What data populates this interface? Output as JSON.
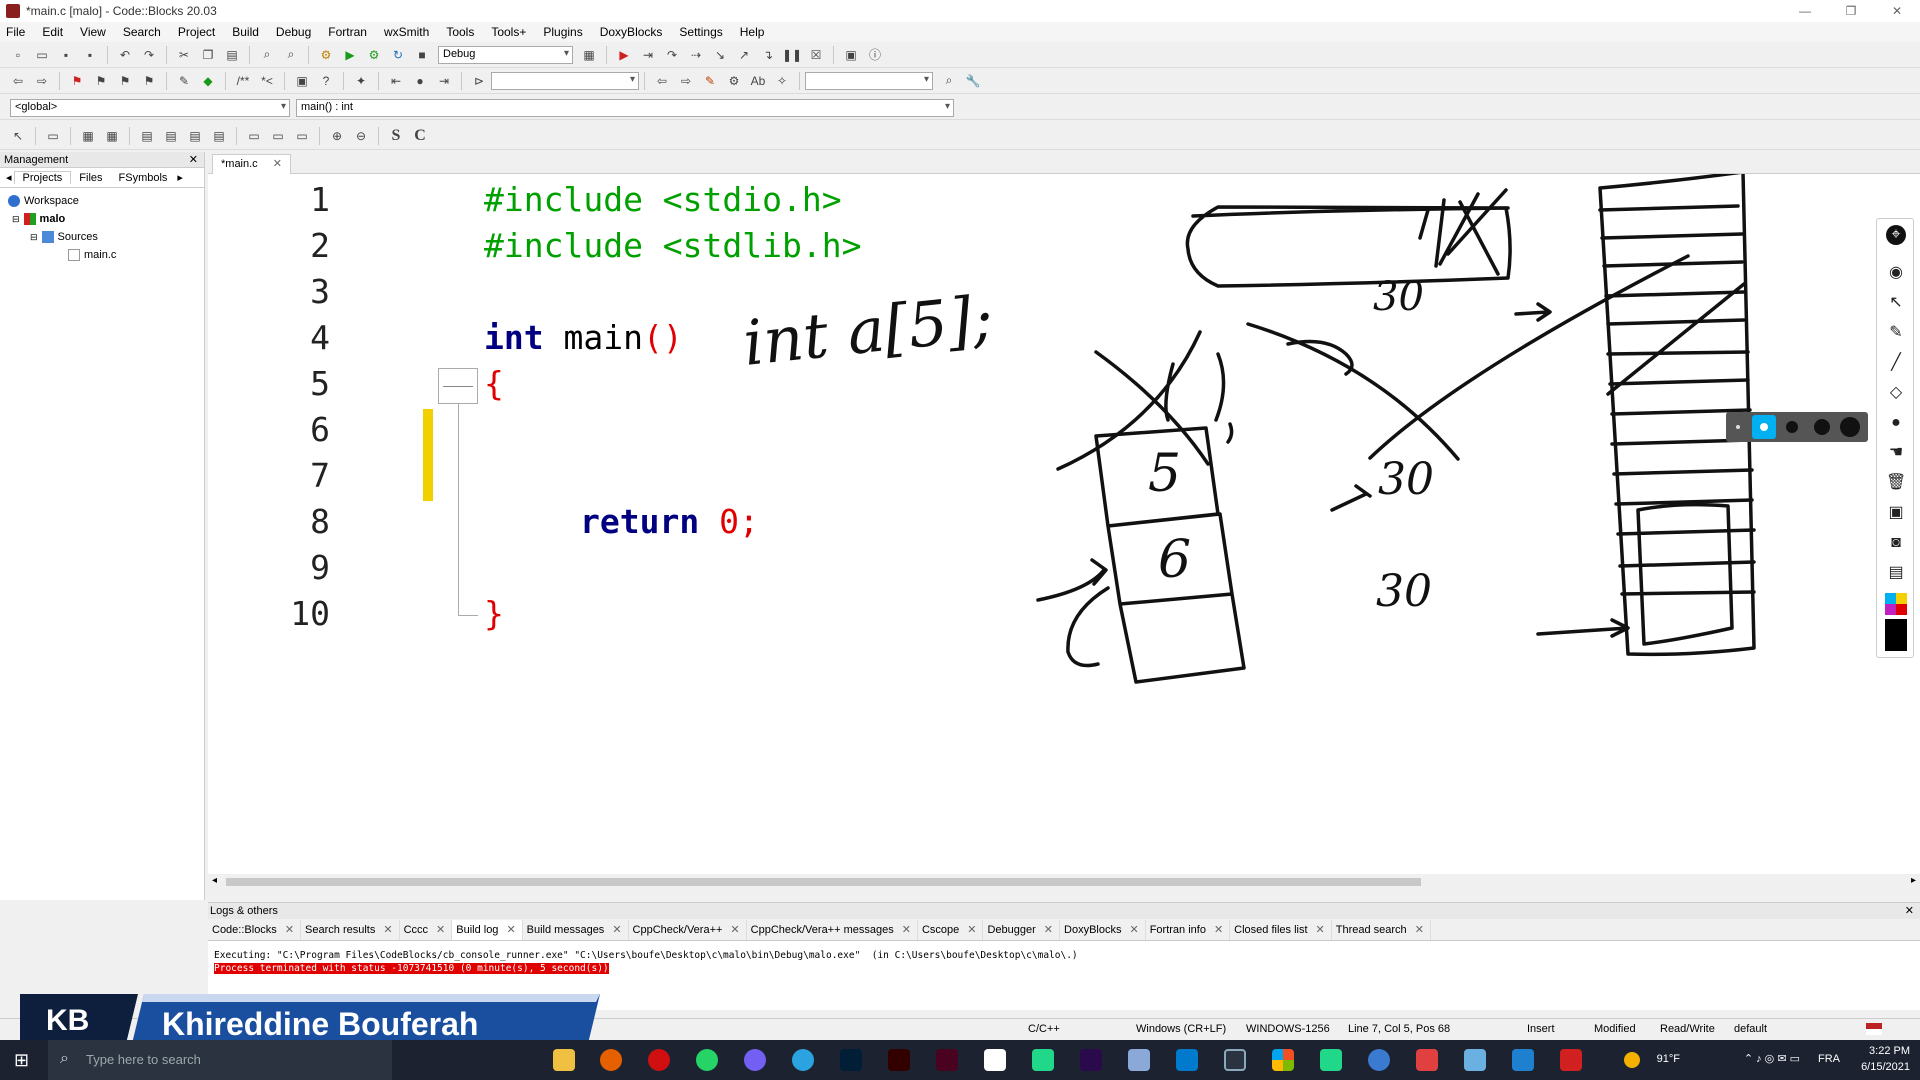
{
  "window": {
    "title": "*main.c [malo] - Code::Blocks 20.03",
    "controls": [
      "—",
      "❐",
      "✕"
    ]
  },
  "menu": [
    "File",
    "Edit",
    "View",
    "Search",
    "Project",
    "Build",
    "Debug",
    "Fortran",
    "wxSmith",
    "Tools",
    "Tools+",
    "Plugins",
    "DoxyBlocks",
    "Settings",
    "Help"
  ],
  "toolbar": {
    "build_target": "Debug",
    "scope": "<global>",
    "symbol": "main() : int"
  },
  "management": {
    "title": "Management",
    "tabs": [
      "Projects",
      "Files",
      "FSymbols"
    ],
    "tree": {
      "workspace": "Workspace",
      "project": "malo",
      "folder": "Sources",
      "file": "main.c"
    }
  },
  "editor": {
    "tab_label": "*main.c",
    "line_numbers": [
      "1",
      "2",
      "3",
      "4",
      "5",
      "6",
      "7",
      "8",
      "9",
      "10"
    ],
    "lines": {
      "l1": "#include <stdio.h>",
      "l2": "#include <stdlib.h>",
      "l4_kw": "int",
      "l4_rest": " main",
      "l4_parens": "()",
      "l5": "{",
      "l8_kw": "return",
      "l8_num": "0",
      "l8_semi": ";",
      "l9": "}"
    }
  },
  "annotations": {
    "decl": "int a[5];",
    "num_top": "30",
    "num_mid": "30",
    "num_bot": "30",
    "box1": "5",
    "box2": "6"
  },
  "logs": {
    "title": "Logs & others",
    "tabs": [
      "Code::Blocks",
      "Search results",
      "Cccc",
      "Build log",
      "Build messages",
      "CppCheck/Vera++",
      "CppCheck/Vera++ messages",
      "Cscope",
      "Debugger",
      "DoxyBlocks",
      "Fortran info",
      "Closed files list",
      "Thread search"
    ],
    "active_tab": "Build log",
    "lines": [
      "Executing: \"C:\\Program Files\\CodeBlocks/cb_console_runner.exe\" \"C:\\Users\\boufe\\Desktop\\c\\malo\\bin\\Debug\\malo.exe\"  (in C:\\Users\\boufe\\Desktop\\c\\malo\\.)",
      "Process terminated with status -1073741510 (0 minute(s), 5 second(s))"
    ]
  },
  "status": {
    "language": "C/C++",
    "eol": "Windows (CR+LF)",
    "encoding": "WINDOWS-1256",
    "position": "Line 7, Col 5, Pos 68",
    "mode": "Insert",
    "modified": "Modified",
    "access": "Read/Write",
    "profile": "default"
  },
  "overlay": {
    "badge": "KB",
    "name": "Khireddine Bouferah"
  },
  "taskbar": {
    "search_placeholder": "Type here to search",
    "temperature": "91°F",
    "language": "FRA",
    "time": "3:22 PM",
    "date": "6/15/2021"
  },
  "colors": {
    "keyword": "#000080",
    "preprocessor": "#00a000",
    "number": "#e00000",
    "error_bg": "#e00000",
    "change_bar": "#f2d000"
  }
}
